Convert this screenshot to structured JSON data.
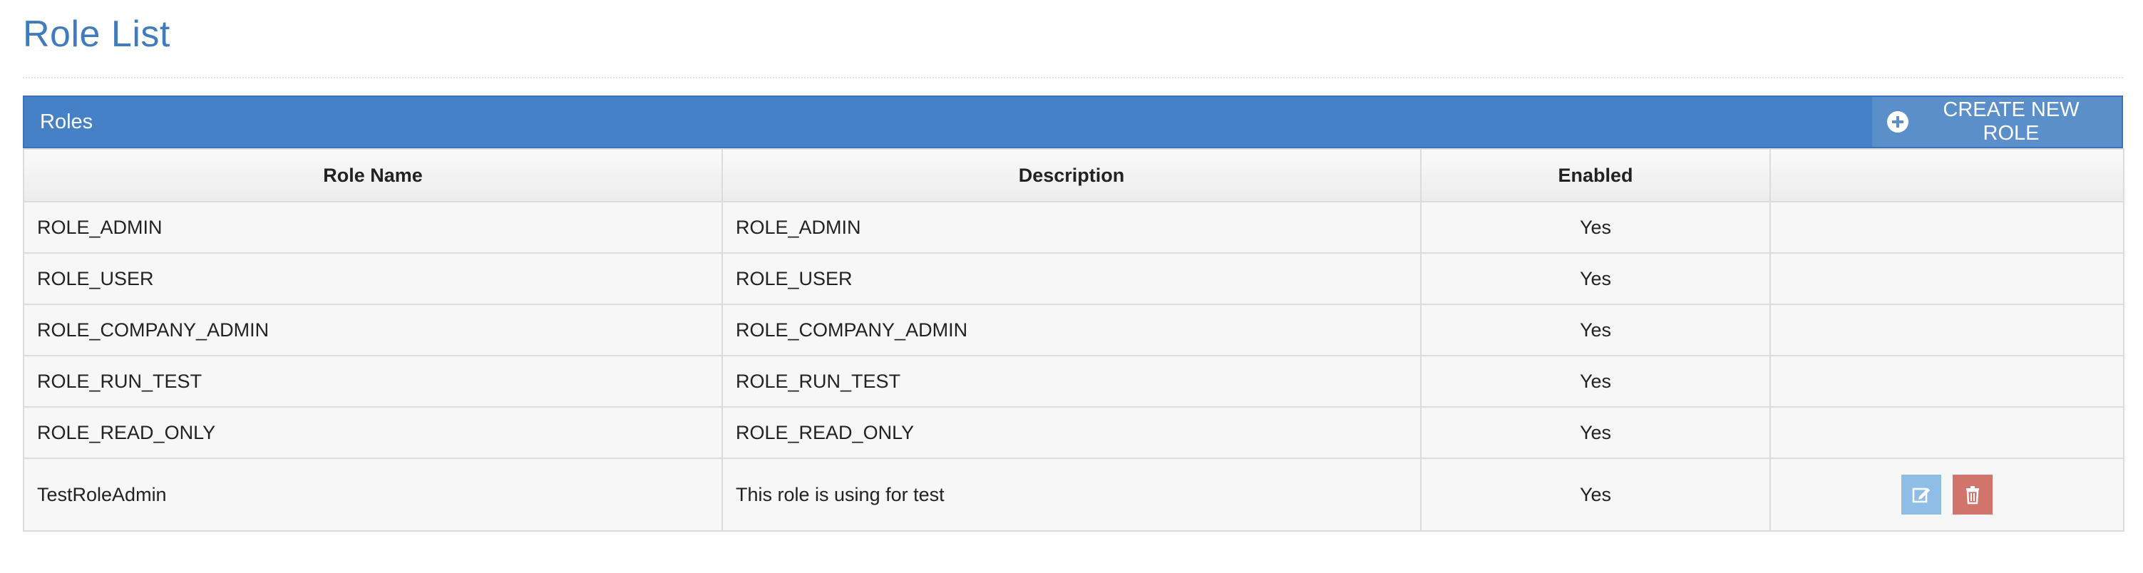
{
  "page": {
    "title": "Role List"
  },
  "panel": {
    "title": "Roles",
    "create_button_label": "CREATE NEW ROLE",
    "create_button_icon": "plus-circle-icon"
  },
  "table": {
    "columns": [
      "Role Name",
      "Description",
      "Enabled",
      ""
    ],
    "rows": [
      {
        "name": "ROLE_ADMIN",
        "description": "ROLE_ADMIN",
        "enabled": "Yes",
        "actions": false
      },
      {
        "name": "ROLE_USER",
        "description": "ROLE_USER",
        "enabled": "Yes",
        "actions": false
      },
      {
        "name": "ROLE_COMPANY_ADMIN",
        "description": "ROLE_COMPANY_ADMIN",
        "enabled": "Yes",
        "actions": false
      },
      {
        "name": "ROLE_RUN_TEST",
        "description": "ROLE_RUN_TEST",
        "enabled": "Yes",
        "actions": false
      },
      {
        "name": "ROLE_READ_ONLY",
        "description": "ROLE_READ_ONLY",
        "enabled": "Yes",
        "actions": false
      },
      {
        "name": "TestRoleAdmin",
        "description": "This role is using for test",
        "enabled": "Yes",
        "actions": true,
        "action_icons": [
          "edit-icon",
          "trash-icon"
        ]
      }
    ]
  },
  "colors": {
    "title": "#3f7bbd",
    "panel_heading": "#4680c6",
    "create_button": "#5b8fca",
    "edit_button": "#8fbde6",
    "delete_button": "#d0746c"
  }
}
